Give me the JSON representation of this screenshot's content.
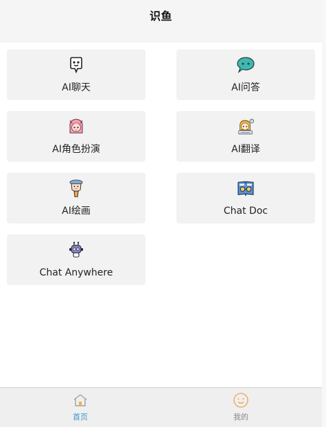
{
  "header": {
    "title": "识鱼"
  },
  "features": [
    {
      "label": "AI聊天",
      "icon": "chat-bot-face-icon"
    },
    {
      "label": "AI问答",
      "icon": "speech-bubble-icon"
    },
    {
      "label": "AI角色扮演",
      "icon": "anime-girl-avatar-icon"
    },
    {
      "label": "AI翻译",
      "icon": "translator-girl-icon"
    },
    {
      "label": "AI绘画",
      "icon": "painter-character-icon"
    },
    {
      "label": "Chat Doc",
      "icon": "open-book-glasses-icon"
    },
    {
      "label": "Chat Anywhere",
      "icon": "robot-icon"
    }
  ],
  "tabbar": {
    "items": [
      {
        "label": "首页",
        "icon": "home-icon",
        "active": true
      },
      {
        "label": "我的",
        "icon": "smiley-face-icon",
        "active": false
      }
    ]
  },
  "colors": {
    "accent": "#3a95cf",
    "card_bg": "#f2f2f2",
    "tabbar_bg": "#efefef",
    "header_bg": "#f5f5f5",
    "teal_bubble": "#3fb8b0",
    "orange_face": "#f4a04a"
  }
}
